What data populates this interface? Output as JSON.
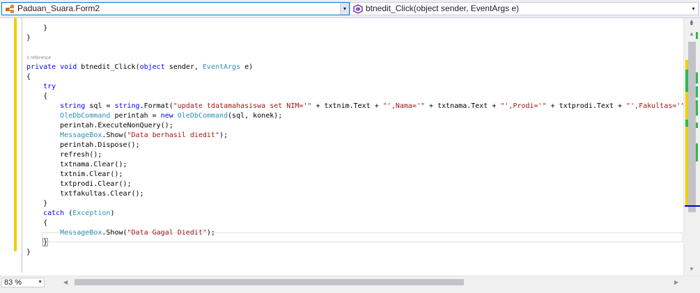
{
  "navbar": {
    "class_combo": "Paduan_Suara.Form2",
    "member_combo": "btnedit_Click(object sender, EventArgs e)",
    "drop_glyph": "▾"
  },
  "code": {
    "l_close_inner": "    }",
    "l_close_method": "}",
    "ref_count": "1 reference",
    "sig": {
      "private": "private",
      "void": "void",
      "name": " btnedit_Click(",
      "object": "object",
      "sender": " sender, ",
      "eventargs": "EventArgs",
      "end": " e)"
    },
    "open_brace": "{",
    "try": "try",
    "try_open": "    {",
    "sql": {
      "indent": "        ",
      "string": "string",
      "mid": " sql = ",
      "string2": "string",
      "format": ".Format(",
      "s1": "\"update tdatamahasiswa set NIM='\"",
      "p1": " + txtnim.Text + ",
      "s2": "\"',Nama='\"",
      "p2": " + txtnama.Text + ",
      "s3": "\"',Prodi='\"",
      "p3": " + txtprodi.Text + ",
      "s4": "\"',Fakultas='\"",
      "p4": " +"
    },
    "cmd": {
      "indent": "        ",
      "type": "OleDbCommand",
      "mid": " perintah = ",
      "new": "new",
      "sp": " ",
      "type2": "OleDbCommand",
      "end": "(sql, konek);"
    },
    "exec": "        perintah.ExecuteNonQuery();",
    "msg1": {
      "indent": "        ",
      "type": "MessageBox",
      "mid": ".Show(",
      "str": "\"Data berhasil diedit\"",
      "end": ");"
    },
    "dispose": "        perintah.Dispose();",
    "refresh": "        refresh();",
    "clr1": "        txtnama.Clear();",
    "clr2": "        txtnim.Clear();",
    "clr3": "        txtprodi.Clear();",
    "clr4": "        txtfakultas.Clear();",
    "try_close": "    }",
    "catch": {
      "indent": "    ",
      "kw": "catch",
      "open": " (",
      "type": "Exception",
      "close": ")"
    },
    "catch_open": "    {",
    "msg2": {
      "indent": "        ",
      "type": "MessageBox",
      "mid": ".Show(",
      "str": "\"Data Gagal Diedit\"",
      "end": ");"
    },
    "catch_close_indent": "    ",
    "catch_close": "}",
    "method_close": "}"
  },
  "vscroll": {
    "splitter_glyph": "⇟",
    "up_glyph": "▲",
    "down_glyph": "▼"
  },
  "hscroll": {
    "zoom": "83 %",
    "zoom_glyph": "▼",
    "left_glyph": "◀",
    "right_glyph": "▶"
  },
  "colors": {
    "keyword": "#0000ff",
    "type": "#2b91af",
    "string": "#a31515",
    "change_bar": "#f0d000",
    "saved_mark": "#2db84d",
    "accent": "#007acc"
  }
}
